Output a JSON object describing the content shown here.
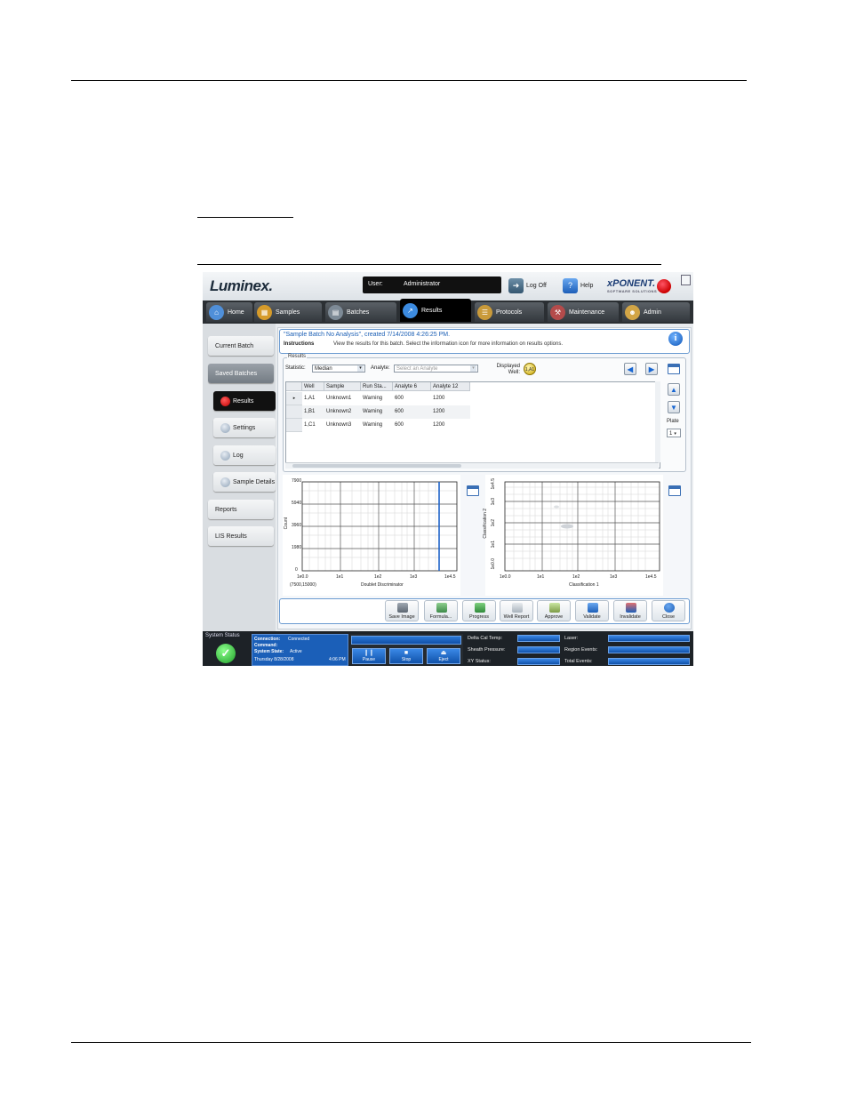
{
  "app": {
    "logo": "Luminex.",
    "user_label": "User:",
    "user_value": "Administrator",
    "logoff_label": "Log Off",
    "help_label": "Help",
    "brand": "xPONENT.",
    "brand_sub": "SOFTWARE SOLUTIONS"
  },
  "tabs": [
    "Home",
    "Samples",
    "Batches",
    "Results",
    "Protocols",
    "Maintenance",
    "Admin"
  ],
  "active_tab": "Results",
  "sidebar": [
    {
      "label": "Current Batch"
    },
    {
      "label": "Saved Batches"
    },
    {
      "label": "Results"
    },
    {
      "label": "Settings"
    },
    {
      "label": "Log"
    },
    {
      "label": "Sample Details"
    },
    {
      "label": "Reports"
    },
    {
      "label": "LIS Results"
    }
  ],
  "header": {
    "title": "\"Sample Batch No Analysis\", created 7/14/2008 4:26:25 PM.",
    "instructions_label": "Instructions",
    "instructions_text": "View the results for this batch. Select the information icon for more information on results options."
  },
  "results": {
    "legend": "Results",
    "statistic_label": "Statistic:",
    "statistic_value": "Median",
    "analyte_label": "Analyte:",
    "analyte_placeholder": "Select an Analyte",
    "displayed_well_label": "Displayed Well:",
    "displayed_well_value": "1,A1",
    "plate_label": "Plate",
    "plate_value": "1",
    "columns": [
      "Well",
      "Sample",
      "Run Sta...",
      "Analyte 6",
      "Analyte 12"
    ],
    "rows": [
      [
        "1,A1",
        "Unknown1",
        "Warning",
        "600",
        "1200"
      ],
      [
        "1,B1",
        "Unknown2",
        "Warning",
        "600",
        "1200"
      ],
      [
        "1,C1",
        "Unknown3",
        "Warning",
        "600",
        "1200"
      ]
    ]
  },
  "plot1": {
    "ylabel": "Count",
    "xlabel": "Doublet Discriminator",
    "gate": "(7500,15000)",
    "yticks": [
      "0",
      "1980",
      "3960",
      "5940",
      "7900"
    ],
    "xticks": [
      "1e0.0",
      "1e1",
      "1e2",
      "1e3",
      "1e4.5"
    ]
  },
  "plot2": {
    "ylabel": "Classification 2",
    "xlabel": "Classification 1",
    "yticks": [
      "1e0.0",
      "1e1",
      "1e2",
      "1e3",
      "1e4.5"
    ],
    "xticks": [
      "1e0.0",
      "1e1",
      "1e2",
      "1e3",
      "1e4.5"
    ]
  },
  "toolbar": [
    "Save Image",
    "Formula...",
    "Progress",
    "Well Report",
    "Approve",
    "Validate",
    "Invalidate",
    "Close"
  ],
  "status": {
    "system_status_label": "System Status",
    "connection_label": "Connection:",
    "connection_value": "Connected",
    "command_label": "Command:",
    "system_state_label": "System State:",
    "system_state_value": "Active",
    "date": "Thursday 8/28/2008",
    "time": "4:06 PM",
    "pause_label": "Pause",
    "stop_label": "Stop",
    "eject_label": "Eject",
    "delta_cal_label": "Delta Cal Temp:",
    "sheath_label": "Sheath Pressure:",
    "xy_label": "XY Status:",
    "laser_label": "Laser:",
    "region_events_label": "Region Events:",
    "total_events_label": "Total Events:"
  }
}
